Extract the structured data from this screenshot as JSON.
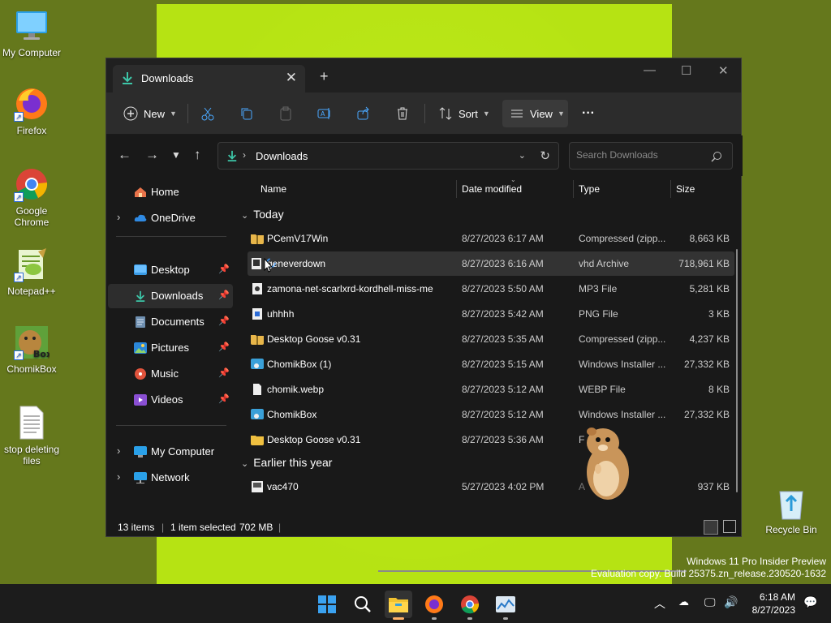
{
  "desktop": {
    "icons": [
      {
        "label": "My Computer"
      },
      {
        "label": "Firefox"
      },
      {
        "label": "Google Chrome"
      },
      {
        "label": "Notepad++"
      },
      {
        "label": "ChomikBox"
      },
      {
        "label": "stop deleting files"
      },
      {
        "label": "Recycle Bin"
      }
    ],
    "watermark_line1": "Windows 11 Pro Insider Preview",
    "watermark_line2": "Evaluation copy. Build 25375.zn_release.230520-1632"
  },
  "window": {
    "tab_title": "Downloads",
    "toolbar": {
      "new_label": "New",
      "sort_label": "Sort",
      "view_label": "View",
      "more_label": "···"
    },
    "address": {
      "path": "Downloads",
      "search_placeholder": "Search Downloads"
    },
    "sidebar": {
      "home": "Home",
      "onedrive": "OneDrive",
      "desktop": "Desktop",
      "downloads": "Downloads",
      "documents": "Documents",
      "pictures": "Pictures",
      "music": "Music",
      "videos": "Videos",
      "my_computer": "My Computer",
      "network": "Network"
    },
    "columns": {
      "name": "Name",
      "date": "Date modified",
      "type": "Type",
      "size": "Size"
    },
    "groups": {
      "today": "Today",
      "earlier": "Earlier this year"
    },
    "files_today": [
      {
        "name": "PCemV17Win",
        "date": "8/27/2023 6:17 AM",
        "type": "Compressed (zipp...",
        "size": "8,663 KB"
      },
      {
        "name": "geneverdown",
        "date": "8/27/2023 6:16 AM",
        "type": "vhd Archive",
        "size": "718,961 KB"
      },
      {
        "name": "zamona-net-scarlxrd-kordhell-miss-me",
        "date": "8/27/2023 5:50 AM",
        "type": "MP3 File",
        "size": "5,281 KB"
      },
      {
        "name": "uhhhh",
        "date": "8/27/2023 5:42 AM",
        "type": "PNG File",
        "size": "3 KB"
      },
      {
        "name": "Desktop Goose v0.31",
        "date": "8/27/2023 5:35 AM",
        "type": "Compressed (zipp...",
        "size": "4,237 KB"
      },
      {
        "name": "ChomikBox (1)",
        "date": "8/27/2023 5:15 AM",
        "type": "Windows Installer ...",
        "size": "27,332 KB"
      },
      {
        "name": "chomik.webp",
        "date": "8/27/2023 5:12 AM",
        "type": "WEBP File",
        "size": "8 KB"
      },
      {
        "name": "ChomikBox",
        "date": "8/27/2023 5:12 AM",
        "type": "Windows Installer ...",
        "size": "27,332 KB"
      },
      {
        "name": "Desktop Goose v0.31",
        "date": "8/27/2023 5:36 AM",
        "type": "F",
        "size": ""
      }
    ],
    "files_earlier": [
      {
        "name": "vac470",
        "date": "5/27/2023 4:02 PM",
        "type": "A",
        "size": "937 KB"
      }
    ],
    "status": {
      "count": "13 items",
      "selected": "1 item selected",
      "size": "702 MB"
    }
  },
  "taskbar": {
    "time": "6:18 AM",
    "date": "8/27/2023"
  }
}
